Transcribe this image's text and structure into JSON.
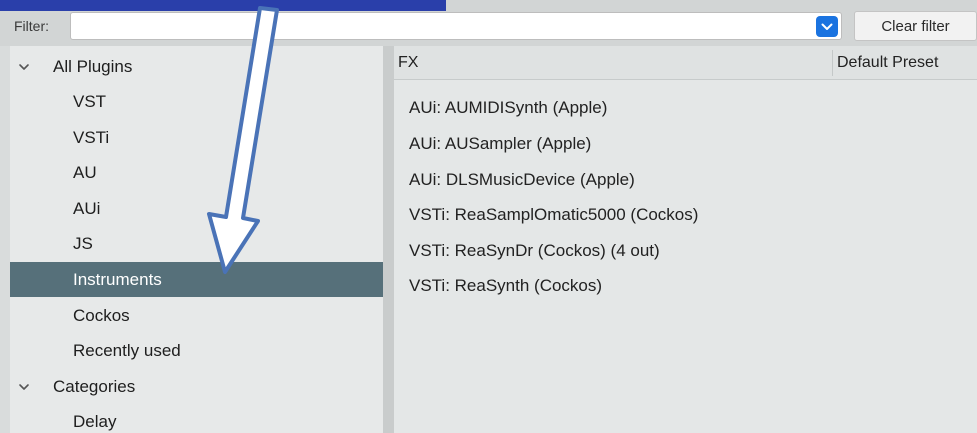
{
  "filter": {
    "label": "Filter:",
    "value": "",
    "clear_label": "Clear filter"
  },
  "tree": {
    "all_plugins": "All Plugins",
    "vst": "VST",
    "vsti": "VSTi",
    "au": "AU",
    "aui": "AUi",
    "js": "JS",
    "instruments": "Instruments",
    "cockos": "Cockos",
    "recently_used": "Recently used",
    "categories": "Categories",
    "delay": "Delay",
    "selected": "Instruments"
  },
  "fx_list": {
    "col_fx": "FX",
    "col_preset": "Default Preset",
    "items": [
      "AUi: AUMIDISynth (Apple)",
      "AUi: AUSampler (Apple)",
      "AUi: DLSMusicDevice (Apple)",
      "VSTi: ReaSamplOmatic5000 (Cockos)",
      "VSTi: ReaSynDr (Cockos) (4 out)",
      "VSTi: ReaSynth (Cockos)"
    ]
  },
  "colors": {
    "selection": "#56707a",
    "dropdown_accent": "#1a73e0",
    "banner": "#2a3faa",
    "annotation_arrow": "#4a73b7"
  },
  "icons": [
    "chevron-down-icon",
    "dropdown-chevron-icon",
    "annotation-arrow"
  ]
}
